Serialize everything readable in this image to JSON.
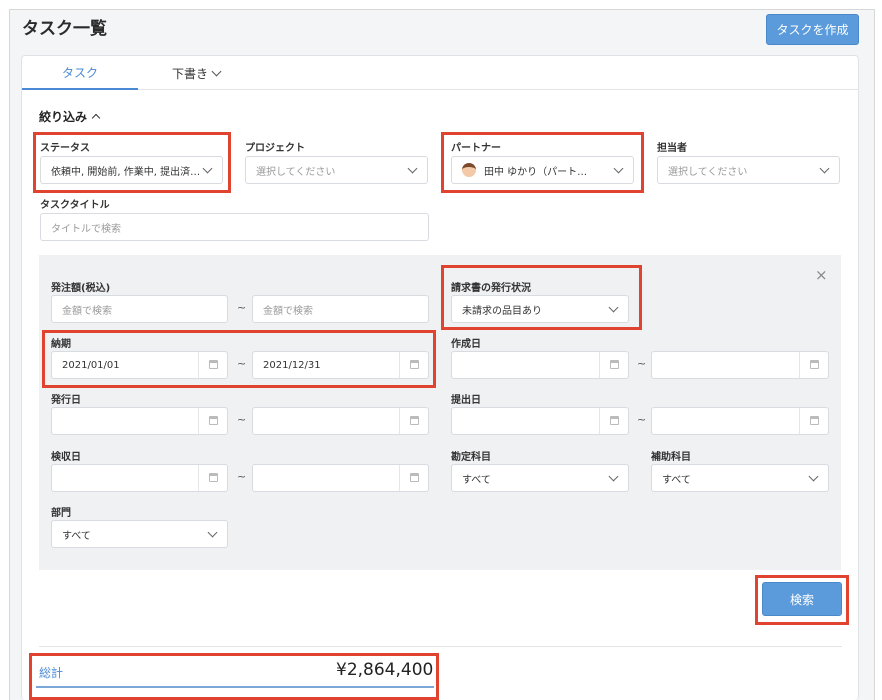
{
  "header": {
    "title": "タスク一覧",
    "create_button": "タスクを作成"
  },
  "tabs": [
    {
      "label": "タスク"
    },
    {
      "label": "下書き"
    }
  ],
  "filters": {
    "toggle_label": "絞り込み",
    "status": {
      "label": "ステータス",
      "value": "依頼中, 開始前, 作業中, 提出済…"
    },
    "project": {
      "label": "プロジェクト",
      "placeholder": "選択してください"
    },
    "partner": {
      "label": "パートナー",
      "value": "田中 ゆかり（パート…"
    },
    "assignee": {
      "label": "担当者",
      "placeholder": "選択してください"
    },
    "task_title": {
      "label": "タスクタイトル",
      "placeholder": "タイトルで検索"
    },
    "order_amount": {
      "label": "発注額(税込)",
      "from_placeholder": "金額で検索",
      "to_placeholder": "金額で検索"
    },
    "invoice_status": {
      "label": "請求書の発行状況",
      "value": "未請求の品目あり"
    },
    "due_date": {
      "label": "納期",
      "from": "2021/01/01",
      "to": "2021/12/31"
    },
    "created_date": {
      "label": "作成日"
    },
    "issue_date": {
      "label": "発行日"
    },
    "submit_date": {
      "label": "提出日"
    },
    "inspection_date": {
      "label": "検収日"
    },
    "account_item": {
      "label": "勘定科目",
      "value": "すべて"
    },
    "sub_account_item": {
      "label": "補助科目",
      "value": "すべて"
    },
    "department": {
      "label": "部門",
      "value": "すべて"
    },
    "range_sep": "~",
    "close_symbol": "×"
  },
  "actions": {
    "search_button": "検索"
  },
  "summary": {
    "total_label": "総計",
    "total_value": "¥2,864,400"
  },
  "colors": {
    "accent": "#5b9bdb",
    "highlight": "#e0432f",
    "link": "#4a8ad4"
  }
}
